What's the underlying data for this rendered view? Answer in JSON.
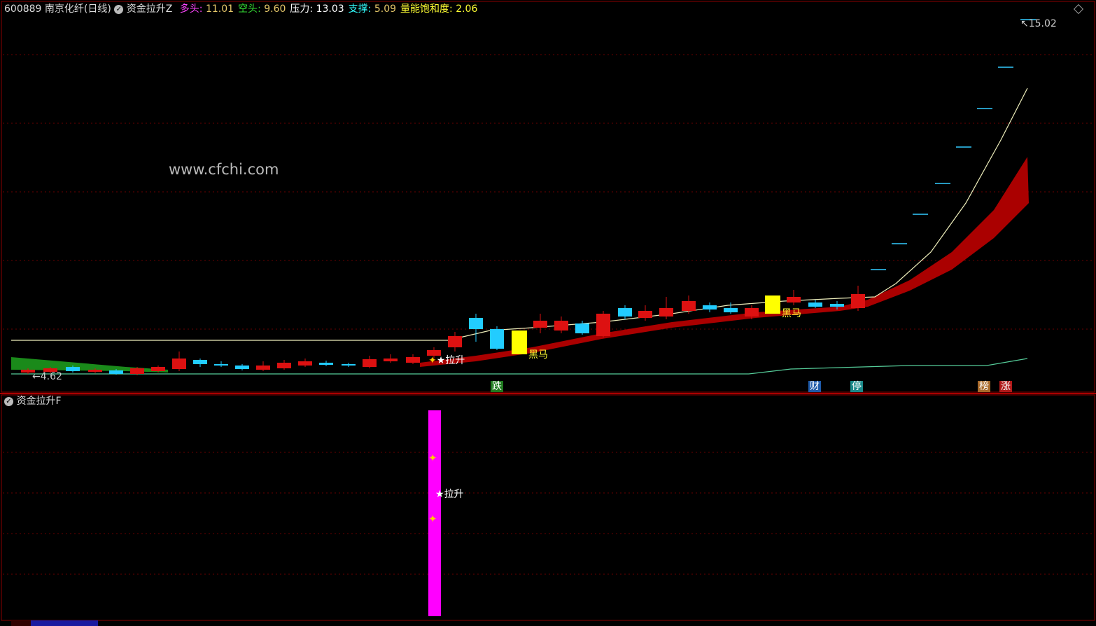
{
  "header": {
    "code": "600889",
    "name": "南京化纤",
    "period": "(日线)",
    "indicator": "资金拉升Z",
    "items": [
      {
        "label": "多头",
        "value": "11.01",
        "color": "#ff44ff"
      },
      {
        "label": "空头",
        "value": "9.60",
        "color": "#33dd33"
      },
      {
        "label": "压力",
        "value": "13.03",
        "color": "#ffffff"
      },
      {
        "label": "支撑",
        "value": "5.09",
        "color": "#33ffff"
      },
      {
        "label": "量能饱和度",
        "value": "2.06",
        "color": "#ffff33"
      }
    ]
  },
  "watermark": "www.cfchi.com",
  "price_high_label": "15.02",
  "price_low_label": "4.62",
  "markers": {
    "lift": "拉升",
    "dark_horse": "黑马"
  },
  "event_tags": [
    {
      "text": "跌",
      "color": "#1f7a1f"
    },
    {
      "text": "财",
      "color": "#1f5aa8"
    },
    {
      "text": "停",
      "color": "#1a8a8a"
    },
    {
      "text": "榜",
      "color": "#a86a2a"
    },
    {
      "text": "涨",
      "color": "#b01a1a"
    }
  ],
  "sub_panel": {
    "title": "资金拉升F",
    "marker": "拉升"
  },
  "colors": {
    "up": "#dd1111",
    "down": "#22ccff",
    "band": "#aa0000",
    "grid": "#5a0000",
    "magenta": "#ff00ff",
    "yellow": "#ffff00"
  }
}
